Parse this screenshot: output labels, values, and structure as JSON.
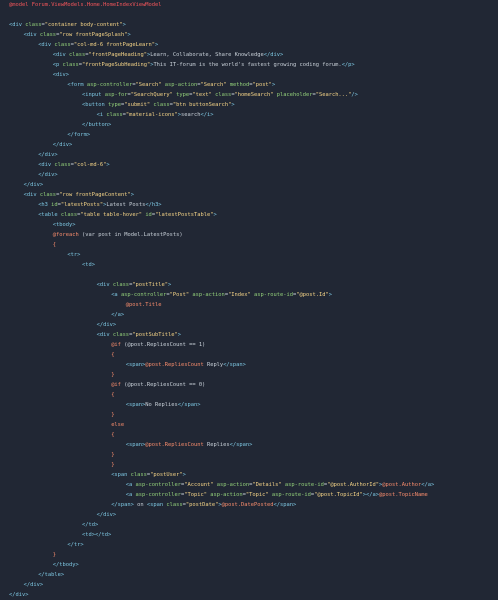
{
  "editor": {
    "lines": [
      {
        "indent": 0,
        "tokens": [
          {
            "t": "@model Forum.ViewModels.Home.HomeIndexViewModel",
            "c": "red"
          }
        ]
      },
      {
        "indent": 0,
        "tokens": []
      },
      {
        "indent": 0,
        "tokens": [
          {
            "t": "<div ",
            "c": "tag"
          },
          {
            "t": "class",
            "c": "attr"
          },
          {
            "t": "=",
            "c": "text"
          },
          {
            "t": "\"container body-content\"",
            "c": "str"
          },
          {
            "t": ">",
            "c": "tag"
          }
        ]
      },
      {
        "indent": 1,
        "tokens": [
          {
            "t": "<div ",
            "c": "tag"
          },
          {
            "t": "class",
            "c": "attr"
          },
          {
            "t": "=",
            "c": "text"
          },
          {
            "t": "\"row frontPageSplash\"",
            "c": "str"
          },
          {
            "t": ">",
            "c": "tag"
          }
        ]
      },
      {
        "indent": 2,
        "tokens": [
          {
            "t": "<div ",
            "c": "tag"
          },
          {
            "t": "class",
            "c": "attr"
          },
          {
            "t": "=",
            "c": "text"
          },
          {
            "t": "\"col-md-6 frontPageLearn\"",
            "c": "str"
          },
          {
            "t": ">",
            "c": "tag"
          }
        ]
      },
      {
        "indent": 3,
        "tokens": [
          {
            "t": "<div ",
            "c": "tag"
          },
          {
            "t": "class",
            "c": "attr"
          },
          {
            "t": "=",
            "c": "text"
          },
          {
            "t": "\"frontPageHeading\"",
            "c": "str"
          },
          {
            "t": ">",
            "c": "tag"
          },
          {
            "t": "Learn, Collaborate, Share Knowledge",
            "c": "text"
          },
          {
            "t": "</div>",
            "c": "tag"
          }
        ]
      },
      {
        "indent": 3,
        "tokens": [
          {
            "t": "<p ",
            "c": "tag"
          },
          {
            "t": "class",
            "c": "attr"
          },
          {
            "t": "=",
            "c": "text"
          },
          {
            "t": "\"frontPageSubHeading\"",
            "c": "str"
          },
          {
            "t": ">",
            "c": "tag"
          },
          {
            "t": "This IT-forum is the world's fastest growing coding forum.",
            "c": "text"
          },
          {
            "t": "</p>",
            "c": "tag"
          }
        ]
      },
      {
        "indent": 3,
        "tokens": [
          {
            "t": "<div>",
            "c": "tag"
          }
        ]
      },
      {
        "indent": 4,
        "tokens": [
          {
            "t": "<form ",
            "c": "tag"
          },
          {
            "t": "asp-controller",
            "c": "attr"
          },
          {
            "t": "=",
            "c": "text"
          },
          {
            "t": "\"Search\" ",
            "c": "str"
          },
          {
            "t": "asp-action",
            "c": "attr"
          },
          {
            "t": "=",
            "c": "text"
          },
          {
            "t": "\"Search\" ",
            "c": "str"
          },
          {
            "t": "method",
            "c": "attr"
          },
          {
            "t": "=",
            "c": "text"
          },
          {
            "t": "\"post\"",
            "c": "str"
          },
          {
            "t": ">",
            "c": "tag"
          }
        ]
      },
      {
        "indent": 5,
        "tokens": [
          {
            "t": "<input ",
            "c": "tag"
          },
          {
            "t": "asp-for",
            "c": "attr"
          },
          {
            "t": "=",
            "c": "text"
          },
          {
            "t": "\"SearchQuery\" ",
            "c": "str"
          },
          {
            "t": "type",
            "c": "attr"
          },
          {
            "t": "=",
            "c": "text"
          },
          {
            "t": "\"text\" ",
            "c": "str"
          },
          {
            "t": "class",
            "c": "attr"
          },
          {
            "t": "=",
            "c": "text"
          },
          {
            "t": "\"homeSearch\" ",
            "c": "str"
          },
          {
            "t": "placeholder",
            "c": "attr"
          },
          {
            "t": "=",
            "c": "text"
          },
          {
            "t": "\"Search...\"",
            "c": "str"
          },
          {
            "t": "/>",
            "c": "tag"
          }
        ]
      },
      {
        "indent": 5,
        "tokens": [
          {
            "t": "<button ",
            "c": "tag"
          },
          {
            "t": "type",
            "c": "attr"
          },
          {
            "t": "=",
            "c": "text"
          },
          {
            "t": "\"submit\" ",
            "c": "str"
          },
          {
            "t": "class",
            "c": "attr"
          },
          {
            "t": "=",
            "c": "text"
          },
          {
            "t": "\"btn buttonSearch\"",
            "c": "str"
          },
          {
            "t": ">",
            "c": "tag"
          }
        ]
      },
      {
        "indent": 6,
        "tokens": [
          {
            "t": "<i ",
            "c": "tag"
          },
          {
            "t": "class",
            "c": "attr"
          },
          {
            "t": "=",
            "c": "text"
          },
          {
            "t": "\"material-icons\"",
            "c": "str"
          },
          {
            "t": ">",
            "c": "tag"
          },
          {
            "t": "search",
            "c": "text"
          },
          {
            "t": "</i>",
            "c": "tag"
          }
        ]
      },
      {
        "indent": 5,
        "tokens": [
          {
            "t": "</button>",
            "c": "tag"
          }
        ]
      },
      {
        "indent": 4,
        "tokens": [
          {
            "t": "</form>",
            "c": "tag"
          }
        ]
      },
      {
        "indent": 3,
        "tokens": [
          {
            "t": "</div>",
            "c": "tag"
          }
        ]
      },
      {
        "indent": 2,
        "tokens": [
          {
            "t": "</div>",
            "c": "tag"
          }
        ]
      },
      {
        "indent": 2,
        "tokens": [
          {
            "t": "<div ",
            "c": "tag"
          },
          {
            "t": "class",
            "c": "attr"
          },
          {
            "t": "=",
            "c": "text"
          },
          {
            "t": "\"col-md-6\"",
            "c": "str"
          },
          {
            "t": ">",
            "c": "tag"
          }
        ]
      },
      {
        "indent": 2,
        "tokens": [
          {
            "t": "</div>",
            "c": "tag"
          }
        ]
      },
      {
        "indent": 1,
        "tokens": [
          {
            "t": "</div>",
            "c": "tag"
          }
        ]
      },
      {
        "indent": 1,
        "tokens": [
          {
            "t": "<div ",
            "c": "tag"
          },
          {
            "t": "class",
            "c": "attr"
          },
          {
            "t": "=",
            "c": "text"
          },
          {
            "t": "\"row frontPageContent\"",
            "c": "str"
          },
          {
            "t": ">",
            "c": "tag"
          }
        ]
      },
      {
        "indent": 2,
        "tokens": [
          {
            "t": "<h3 ",
            "c": "tag"
          },
          {
            "t": "id",
            "c": "attr"
          },
          {
            "t": "=",
            "c": "text"
          },
          {
            "t": "\"latestPosts\"",
            "c": "str"
          },
          {
            "t": ">",
            "c": "tag"
          },
          {
            "t": "Latest Posts",
            "c": "text"
          },
          {
            "t": "</h3>",
            "c": "tag"
          }
        ]
      },
      {
        "indent": 2,
        "tokens": [
          {
            "t": "<table ",
            "c": "tag"
          },
          {
            "t": "class",
            "c": "attr"
          },
          {
            "t": "=",
            "c": "text"
          },
          {
            "t": "\"table table-hover\" ",
            "c": "str"
          },
          {
            "t": "id",
            "c": "attr"
          },
          {
            "t": "=",
            "c": "text"
          },
          {
            "t": "\"latestPostsTable\"",
            "c": "str"
          },
          {
            "t": ">",
            "c": "tag"
          }
        ]
      },
      {
        "indent": 3,
        "tokens": [
          {
            "t": "<tbody>",
            "c": "tag"
          }
        ]
      },
      {
        "indent": 3,
        "tokens": [
          {
            "t": "@foreach ",
            "c": "razor"
          },
          {
            "t": "(var post in Model.LatestPosts)",
            "c": "text"
          }
        ]
      },
      {
        "indent": 3,
        "tokens": [
          {
            "t": "{",
            "c": "razor"
          }
        ]
      },
      {
        "indent": 4,
        "tokens": [
          {
            "t": "<tr>",
            "c": "tag"
          }
        ]
      },
      {
        "indent": 5,
        "tokens": [
          {
            "t": "<td>",
            "c": "tag"
          }
        ]
      },
      {
        "indent": 0,
        "tokens": []
      },
      {
        "indent": 6,
        "tokens": [
          {
            "t": "<div ",
            "c": "tag"
          },
          {
            "t": "class",
            "c": "attr"
          },
          {
            "t": "=",
            "c": "text"
          },
          {
            "t": "\"postTitle\"",
            "c": "str"
          },
          {
            "t": ">",
            "c": "tag"
          }
        ]
      },
      {
        "indent": 7,
        "tokens": [
          {
            "t": "<a ",
            "c": "tag"
          },
          {
            "t": "asp-controller",
            "c": "attr"
          },
          {
            "t": "=",
            "c": "text"
          },
          {
            "t": "\"Post\" ",
            "c": "str"
          },
          {
            "t": "asp-action",
            "c": "attr"
          },
          {
            "t": "=",
            "c": "text"
          },
          {
            "t": "\"Index\" ",
            "c": "str"
          },
          {
            "t": "asp-route-id",
            "c": "attr"
          },
          {
            "t": "=",
            "c": "text"
          },
          {
            "t": "\"@post.Id\"",
            "c": "str"
          },
          {
            "t": ">",
            "c": "tag"
          }
        ]
      },
      {
        "indent": 8,
        "tokens": [
          {
            "t": "@post.Title",
            "c": "razor"
          }
        ]
      },
      {
        "indent": 7,
        "tokens": [
          {
            "t": "</a>",
            "c": "tag"
          }
        ]
      },
      {
        "indent": 6,
        "tokens": [
          {
            "t": "</div>",
            "c": "tag"
          }
        ]
      },
      {
        "indent": 6,
        "tokens": [
          {
            "t": "<div ",
            "c": "tag"
          },
          {
            "t": "class",
            "c": "attr"
          },
          {
            "t": "=",
            "c": "text"
          },
          {
            "t": "\"postSubTitle\"",
            "c": "str"
          },
          {
            "t": ">",
            "c": "tag"
          }
        ]
      },
      {
        "indent": 7,
        "tokens": [
          {
            "t": "@if ",
            "c": "razor"
          },
          {
            "t": "(@post.RepliesCount == 1)",
            "c": "text"
          }
        ]
      },
      {
        "indent": 7,
        "tokens": [
          {
            "t": "{",
            "c": "razor"
          }
        ]
      },
      {
        "indent": 8,
        "tokens": [
          {
            "t": "<span>",
            "c": "tag"
          },
          {
            "t": "@post.RepliesCount",
            "c": "razor"
          },
          {
            "t": " Reply",
            "c": "text"
          },
          {
            "t": "</span>",
            "c": "tag"
          }
        ]
      },
      {
        "indent": 7,
        "tokens": [
          {
            "t": "}",
            "c": "razor"
          }
        ]
      },
      {
        "indent": 7,
        "tokens": [
          {
            "t": "@if ",
            "c": "razor"
          },
          {
            "t": "(@post.RepliesCount == 0)",
            "c": "text"
          }
        ]
      },
      {
        "indent": 7,
        "tokens": [
          {
            "t": "{",
            "c": "razor"
          }
        ]
      },
      {
        "indent": 8,
        "tokens": [
          {
            "t": "<span>",
            "c": "tag"
          },
          {
            "t": "No Replies",
            "c": "text"
          },
          {
            "t": "</span>",
            "c": "tag"
          }
        ]
      },
      {
        "indent": 7,
        "tokens": [
          {
            "t": "}",
            "c": "razor"
          }
        ]
      },
      {
        "indent": 7,
        "tokens": [
          {
            "t": "else",
            "c": "razor"
          }
        ]
      },
      {
        "indent": 7,
        "tokens": [
          {
            "t": "{",
            "c": "razor"
          }
        ]
      },
      {
        "indent": 8,
        "tokens": [
          {
            "t": "<span>",
            "c": "tag"
          },
          {
            "t": "@post.RepliesCount",
            "c": "razor"
          },
          {
            "t": " Replies",
            "c": "text"
          },
          {
            "t": "</span>",
            "c": "tag"
          }
        ]
      },
      {
        "indent": 7,
        "tokens": [
          {
            "t": "}",
            "c": "razor"
          }
        ]
      },
      {
        "indent": 7,
        "tokens": [
          {
            "t": "}",
            "c": "razor"
          }
        ]
      },
      {
        "indent": 7,
        "tokens": [
          {
            "t": "<span ",
            "c": "tag"
          },
          {
            "t": "class",
            "c": "attr"
          },
          {
            "t": "=",
            "c": "text"
          },
          {
            "t": "\"postUser\"",
            "c": "str"
          },
          {
            "t": ">",
            "c": "tag"
          }
        ]
      },
      {
        "indent": 8,
        "tokens": [
          {
            "t": "<a ",
            "c": "tag"
          },
          {
            "t": "asp-controller",
            "c": "attr"
          },
          {
            "t": "=",
            "c": "text"
          },
          {
            "t": "\"Account\" ",
            "c": "str"
          },
          {
            "t": "asp-action",
            "c": "attr"
          },
          {
            "t": "=",
            "c": "text"
          },
          {
            "t": "\"Details\" ",
            "c": "str"
          },
          {
            "t": "asp-route-id",
            "c": "attr"
          },
          {
            "t": "=",
            "c": "text"
          },
          {
            "t": "\"@post.AuthorId\"",
            "c": "str"
          },
          {
            "t": ">",
            "c": "tag"
          },
          {
            "t": "@post.Author",
            "c": "razor"
          },
          {
            "t": "</a>",
            "c": "tag"
          }
        ]
      },
      {
        "indent": 8,
        "tokens": [
          {
            "t": "<a ",
            "c": "tag"
          },
          {
            "t": "asp-controller",
            "c": "attr"
          },
          {
            "t": "=",
            "c": "text"
          },
          {
            "t": "\"Topic\" ",
            "c": "str"
          },
          {
            "t": "asp-action",
            "c": "attr"
          },
          {
            "t": "=",
            "c": "text"
          },
          {
            "t": "\"Topic\" ",
            "c": "str"
          },
          {
            "t": "asp-route-id",
            "c": "attr"
          },
          {
            "t": "=",
            "c": "text"
          },
          {
            "t": "\"@post.TopicId\"",
            "c": "str"
          },
          {
            "t": ">",
            "c": "tag"
          },
          {
            "t": "</a>",
            "c": "tag"
          },
          {
            "t": "@post.TopicName",
            "c": "razor"
          }
        ]
      },
      {
        "indent": 7,
        "tokens": [
          {
            "t": "</span>",
            "c": "tag"
          },
          {
            "t": " on ",
            "c": "text"
          },
          {
            "t": "<span ",
            "c": "tag"
          },
          {
            "t": "class",
            "c": "attr"
          },
          {
            "t": "=",
            "c": "text"
          },
          {
            "t": "\"postDate\"",
            "c": "str"
          },
          {
            "t": ">",
            "c": "tag"
          },
          {
            "t": "@post.DatePosted",
            "c": "razor"
          },
          {
            "t": "</span>",
            "c": "tag"
          }
        ]
      },
      {
        "indent": 6,
        "tokens": [
          {
            "t": "</div>",
            "c": "tag"
          }
        ]
      },
      {
        "indent": 5,
        "tokens": [
          {
            "t": "</td>",
            "c": "tag"
          }
        ]
      },
      {
        "indent": 5,
        "tokens": [
          {
            "t": "<td>",
            "c": "tag"
          },
          {
            "t": "</td>",
            "c": "tag"
          }
        ]
      },
      {
        "indent": 4,
        "tokens": [
          {
            "t": "</tr>",
            "c": "tag"
          }
        ]
      },
      {
        "indent": 3,
        "tokens": [
          {
            "t": "}",
            "c": "razor"
          }
        ]
      },
      {
        "indent": 3,
        "tokens": [
          {
            "t": "</tbody>",
            "c": "tag"
          }
        ]
      },
      {
        "indent": 2,
        "tokens": [
          {
            "t": "</table>",
            "c": "tag"
          }
        ]
      },
      {
        "indent": 1,
        "tokens": [
          {
            "t": "</div>",
            "c": "tag"
          }
        ]
      },
      {
        "indent": 0,
        "tokens": [
          {
            "t": "</div>",
            "c": "tag"
          }
        ]
      }
    ]
  }
}
